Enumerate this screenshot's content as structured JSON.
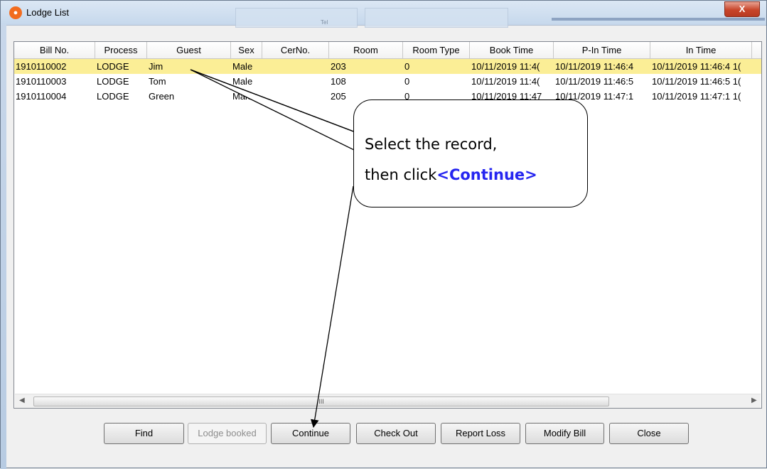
{
  "window": {
    "title": "Lodge List",
    "close_glyph": "X",
    "ghost_label": "Tel"
  },
  "grid": {
    "columns": [
      "Bill No.",
      "Process",
      "Guest",
      "Sex",
      "CerNo.",
      "Room",
      "Room Type",
      "Book Time",
      "P-In Time",
      "In Time"
    ],
    "rows": [
      {
        "bill": "1910110002",
        "process": "LODGE",
        "guest": "Jim",
        "sex": "Male",
        "cer": "",
        "room": "203",
        "roomtype": "0",
        "book": "10/11/2019 11:4(",
        "pin": "10/11/2019 11:46:4",
        "in": "10/11/2019 11:46:4 1("
      },
      {
        "bill": "1910110003",
        "process": "LODGE",
        "guest": "Tom",
        "sex": "Male",
        "cer": "",
        "room": "108",
        "roomtype": "0",
        "book": "10/11/2019 11:4(",
        "pin": "10/11/2019 11:46:5",
        "in": "10/11/2019 11:46:5 1("
      },
      {
        "bill": "1910110004",
        "process": "LODGE",
        "guest": "Green",
        "sex": "Male",
        "cer": "",
        "room": "205",
        "roomtype": "0",
        "book": "10/11/2019 11:47",
        "pin": "10/11/2019 11:47:1",
        "in": "10/11/2019 11:47:1 1("
      }
    ],
    "selected_row": 0,
    "scroll_grip": "III",
    "scroll_left": "◀",
    "scroll_right": "▶"
  },
  "buttons": {
    "find": "Find",
    "lodge_booked": "Lodge booked",
    "continue": "Continue",
    "check_out": "Check Out",
    "report_loss": "Report Loss",
    "modify_bill": "Modify Bill",
    "close": "Close"
  },
  "callout": {
    "line1": "Select the record,",
    "line2_prefix": "then click",
    "line2_accent": "<Continue>",
    "accent_color": "#2525f0"
  },
  "colors": {
    "selection": "#fbee96",
    "close_button": "#c8452a",
    "app_icon": "#f26c1f"
  },
  "icons": {
    "app": "lock-icon",
    "close": "close-icon"
  }
}
